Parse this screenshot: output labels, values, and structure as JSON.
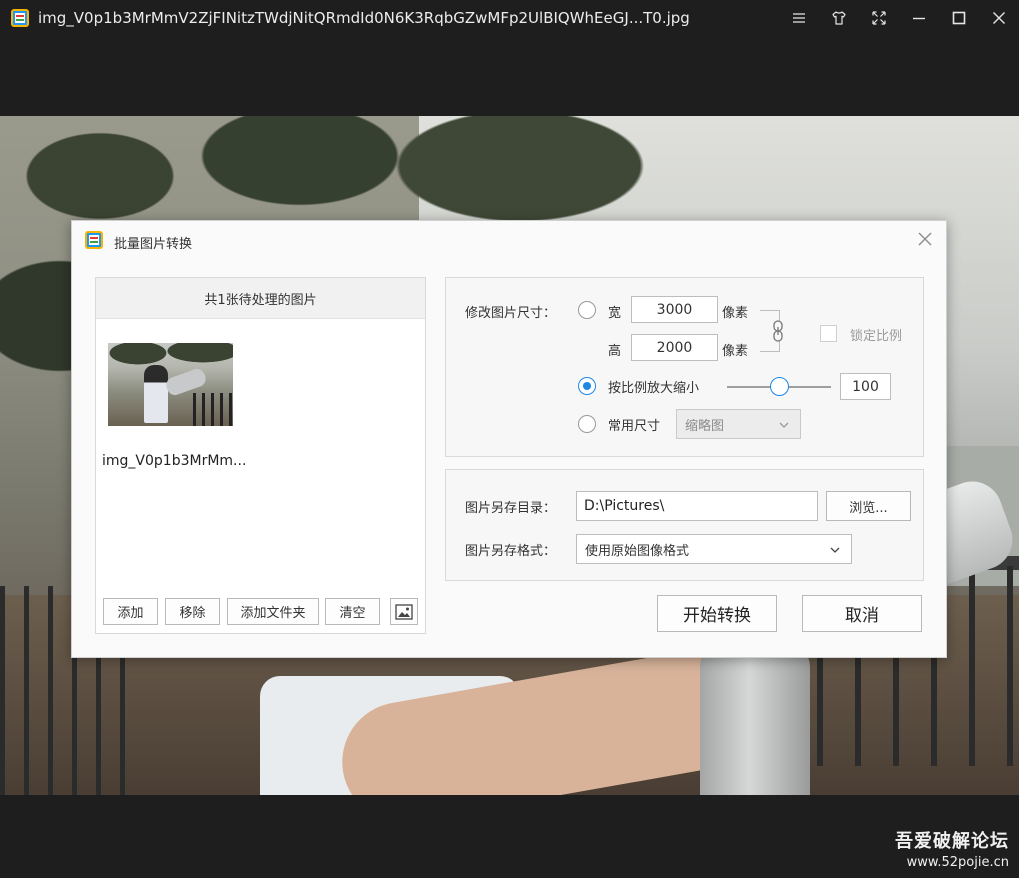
{
  "window": {
    "title": "img_V0p1b3MrMmV2ZjFINitzTWdjNitQRmdId0N6K3RqbGZwMFp2UlBIQWhEeGJ...T0.jpg",
    "controls": [
      "menu-icon",
      "skin-icon",
      "fullscreen-icon",
      "minimize-icon",
      "maximize-icon",
      "close-icon"
    ]
  },
  "dialog": {
    "title": "批量图片转换",
    "left_panel": {
      "header": "共1张待处理的图片",
      "files": [
        {
          "name": "img_V0p1b3MrMm..."
        }
      ],
      "buttons": {
        "add": "添加",
        "remove": "移除",
        "add_folder": "添加文件夹",
        "clear": "清空"
      }
    },
    "resize": {
      "label": "修改图片尺寸：",
      "width_label": "宽",
      "width_value": "3000",
      "height_label": "高",
      "height_value": "2000",
      "unit": "像素",
      "lock_ratio_label": "锁定比例",
      "lock_ratio_checked": false,
      "scale_label": "按比例放大缩小",
      "scale_value": "100",
      "scale_percent": 50,
      "preset_label": "常用尺寸",
      "preset_value": "缩略图",
      "selected_mode": "scale"
    },
    "output": {
      "dir_label": "图片另存目录：",
      "dir_value": "D:\\Pictures\\",
      "browse_label": "浏览...",
      "format_label": "图片另存格式：",
      "format_value": "使用原始图像格式"
    },
    "actions": {
      "start": "开始转换",
      "cancel": "取消"
    }
  },
  "watermark": {
    "title": "吾爱破解论坛",
    "url": "www.52pojie.cn"
  },
  "colors": {
    "accent": "#1e88e5",
    "background": "#1e1e1e",
    "dialog_bg": "#fafafa"
  }
}
